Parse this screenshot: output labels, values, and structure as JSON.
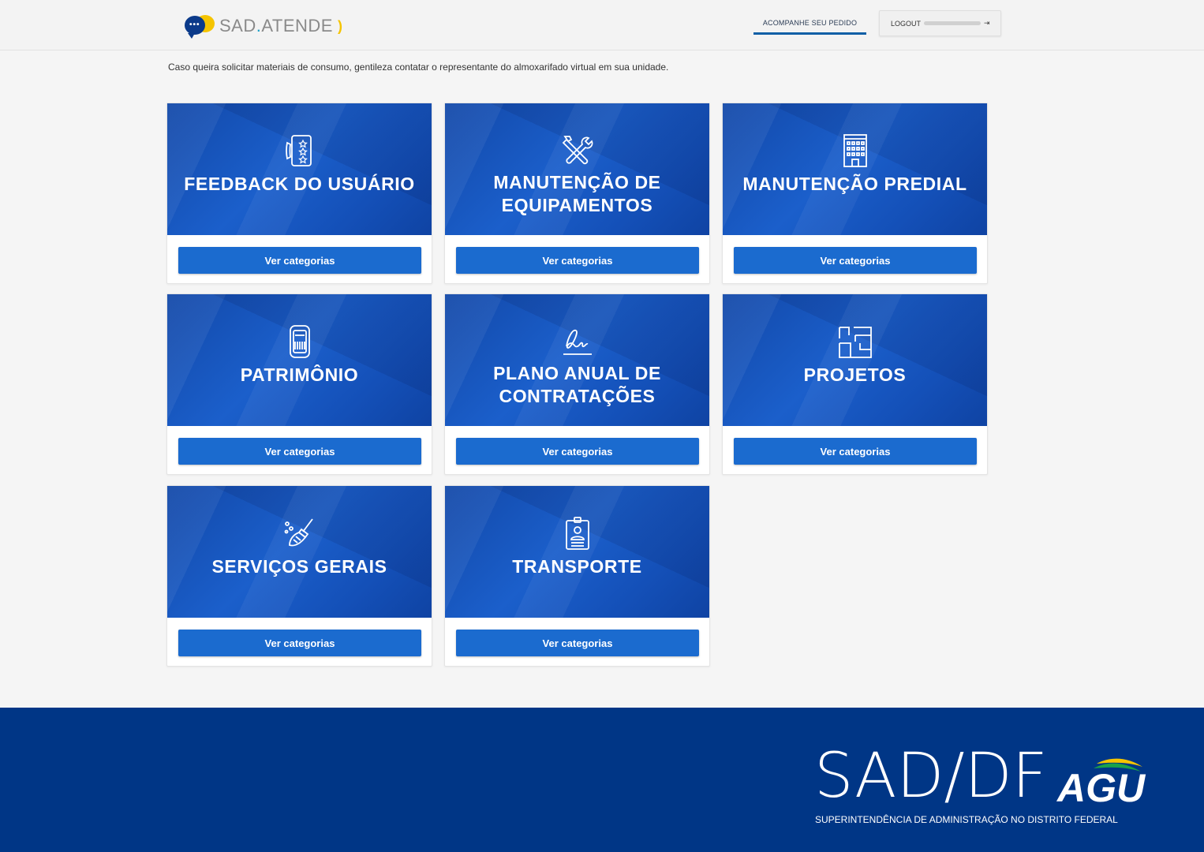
{
  "header": {
    "logo": {
      "part1": "SAD",
      "dot": ".",
      "part2": "ATENDE",
      "waves": ")"
    },
    "nav": {
      "track_label": "ACOMPANHE SEU PEDIDO",
      "logout_label": "LOGOUT"
    }
  },
  "notice": "Caso queira solicitar materiais de consumo, gentileza contatar o representante do almoxarifado virtual em sua unidade.",
  "cards": [
    {
      "title": "FEEDBACK DO USUÁRIO",
      "icon": "phone-rating-icon",
      "button": "Ver categorias"
    },
    {
      "title": "MANUTENÇÃO DE EQUIPAMENTOS",
      "icon": "tools-icon",
      "button": "Ver categorias"
    },
    {
      "title": "MANUTENÇÃO PREDIAL",
      "icon": "building-icon",
      "button": "Ver categorias"
    },
    {
      "title": "PATRIMÔNIO",
      "icon": "asset-tag-icon",
      "button": "Ver categorias"
    },
    {
      "title": "PLANO ANUAL DE CONTRATAÇÕES",
      "icon": "signature-icon",
      "button": "Ver categorias"
    },
    {
      "title": "PROJETOS",
      "icon": "floor-plan-icon",
      "button": "Ver categorias"
    },
    {
      "title": "SERVIÇOS GERAIS",
      "icon": "broom-icon",
      "button": "Ver categorias"
    },
    {
      "title": "TRANSPORTE",
      "icon": "driver-badge-icon",
      "button": "Ver categorias"
    }
  ],
  "footer": {
    "brand": "SAD/DF",
    "agu": "AGU",
    "subtitle": "SUPERINTENDÊNCIA DE ADMINISTRAÇÃO NO DISTRITO FEDERAL"
  },
  "colors": {
    "primary": "#1b6bcf",
    "card_bg": "#1b5fcb",
    "footer_bg": "#003686",
    "accent_yellow": "#f5c400",
    "nav_underline": "#0e5fa6"
  }
}
